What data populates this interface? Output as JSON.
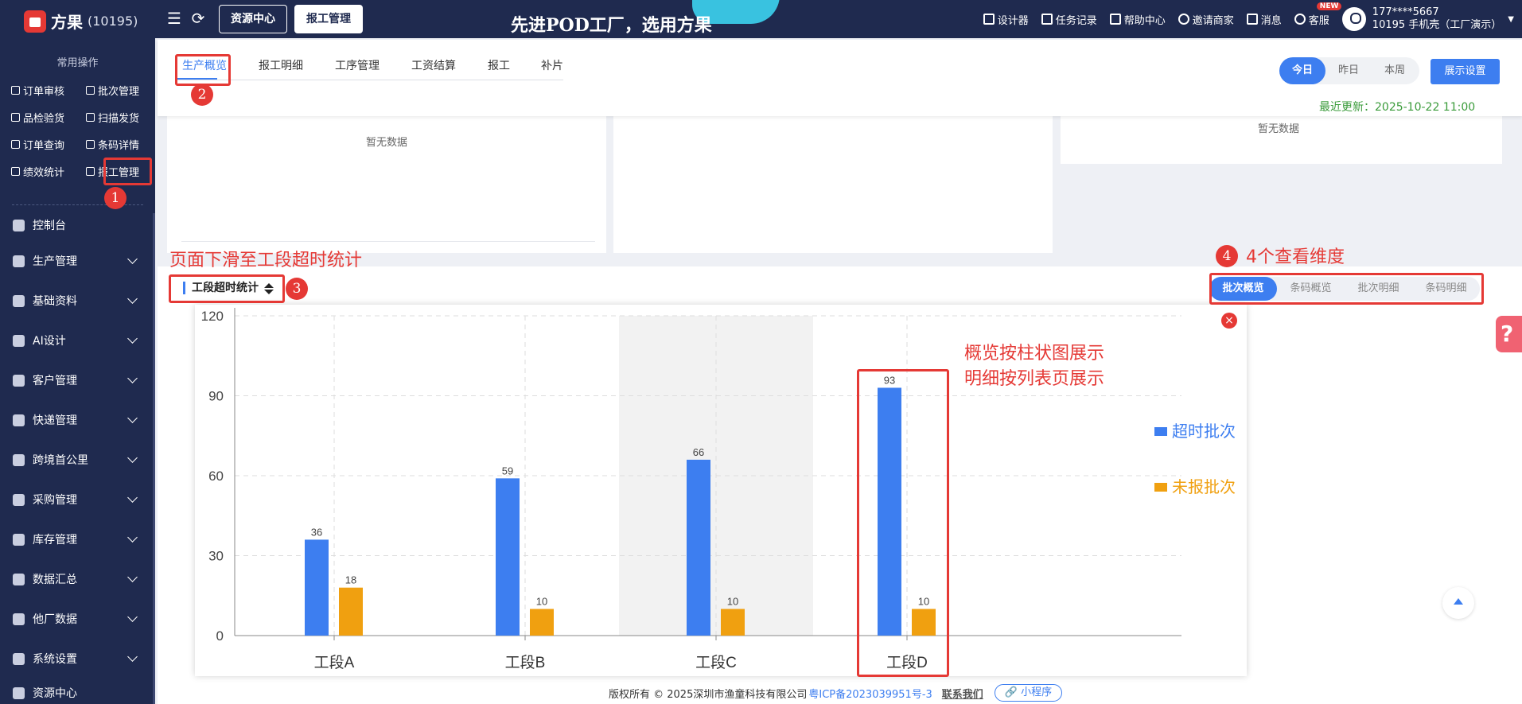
{
  "app": {
    "name": "方果",
    "id": "(10195)"
  },
  "top_nav": {
    "tabs": [
      {
        "label": "资源中心"
      },
      {
        "label": "报工管理"
      }
    ],
    "slogan": "先进POD工厂，选用方果",
    "items": [
      {
        "label": "设计器",
        "icon": "image-icon"
      },
      {
        "label": "任务记录",
        "icon": "list-icon"
      },
      {
        "label": "帮助中心",
        "icon": "help-icon"
      },
      {
        "label": "邀请商家",
        "icon": "users-icon"
      },
      {
        "label": "消息",
        "icon": "message-icon"
      },
      {
        "label": "客服",
        "icon": "headset-icon",
        "badge": "NEW"
      }
    ],
    "user": {
      "phone": "177****5667",
      "account": "10195 手机壳（工厂演示）"
    }
  },
  "sidebar": {
    "quick_title": "常用操作",
    "quick_items": [
      {
        "label": "订单审核"
      },
      {
        "label": "批次管理"
      },
      {
        "label": "品检验货"
      },
      {
        "label": "扫描发货"
      },
      {
        "label": "订单查询"
      },
      {
        "label": "条码详情"
      },
      {
        "label": "绩效统计"
      },
      {
        "label": "报工管理"
      }
    ],
    "menu": [
      {
        "label": "控制台",
        "icon": "dashboard-icon"
      },
      {
        "label": "生产管理",
        "icon": "factory-icon"
      },
      {
        "label": "基础资料",
        "icon": "database-icon"
      },
      {
        "label": "AI设计",
        "icon": "ai-icon"
      },
      {
        "label": "客户管理",
        "icon": "customer-icon"
      },
      {
        "label": "快递管理",
        "icon": "express-icon"
      },
      {
        "label": "跨境首公里",
        "icon": "globe-icon"
      },
      {
        "label": "采购管理",
        "icon": "purchase-icon"
      },
      {
        "label": "库存管理",
        "icon": "warehouse-icon"
      },
      {
        "label": "数据汇总",
        "icon": "pie-icon"
      },
      {
        "label": "他厂数据",
        "icon": "pie2-icon"
      },
      {
        "label": "系统设置",
        "icon": "settings-icon"
      },
      {
        "label": "资源中心",
        "icon": "resource-icon"
      }
    ]
  },
  "page": {
    "tabs": [
      {
        "label": "生产概览"
      },
      {
        "label": "报工明细"
      },
      {
        "label": "工序管理"
      },
      {
        "label": "工资结算"
      },
      {
        "label": "报工"
      },
      {
        "label": "补片"
      }
    ],
    "period": [
      "今日",
      "昨日",
      "本周"
    ],
    "display_settings": "展示设置",
    "updated": "最近更新：2025-10-22 11:00",
    "no_data": "暂无数据",
    "section_title": "工段超时统计",
    "dimensions": [
      "批次概览",
      "条码概览",
      "批次明细",
      "条码明细"
    ]
  },
  "annotations": {
    "nums": [
      "1",
      "2",
      "3",
      "4"
    ],
    "scroll_hint": "页面下滑至工段超时统计",
    "dims_hint": "4个查看维度",
    "chart_hint_1": "概览按柱状图展示",
    "chart_hint_2": "明细按列表页展示"
  },
  "chart_data": {
    "type": "bar",
    "categories": [
      "工段A",
      "工段B",
      "工段C",
      "工段D"
    ],
    "series": [
      {
        "name": "超时批次",
        "values": [
          36,
          59,
          66,
          93
        ],
        "color": "#3d7ef0"
      },
      {
        "name": "未报批次",
        "values": [
          18,
          10,
          10,
          10
        ],
        "color": "#f0a010"
      }
    ],
    "ylim": [
      0,
      120
    ],
    "yticks": [
      "0",
      "30",
      "60",
      "90",
      "120"
    ],
    "grid": true,
    "legend": "right"
  },
  "footer": {
    "copyright": "版权所有 © 2025深圳市渔童科技有限公司",
    "icp": "粤ICP备2023039951号-3",
    "contact": "联系我们",
    "mini_program": "小程序"
  },
  "colors": {
    "brand_dark": "#1f2a4f",
    "accent": "#3d7ef0",
    "annotation": "#e53935",
    "secondary_bar": "#f0a010"
  }
}
